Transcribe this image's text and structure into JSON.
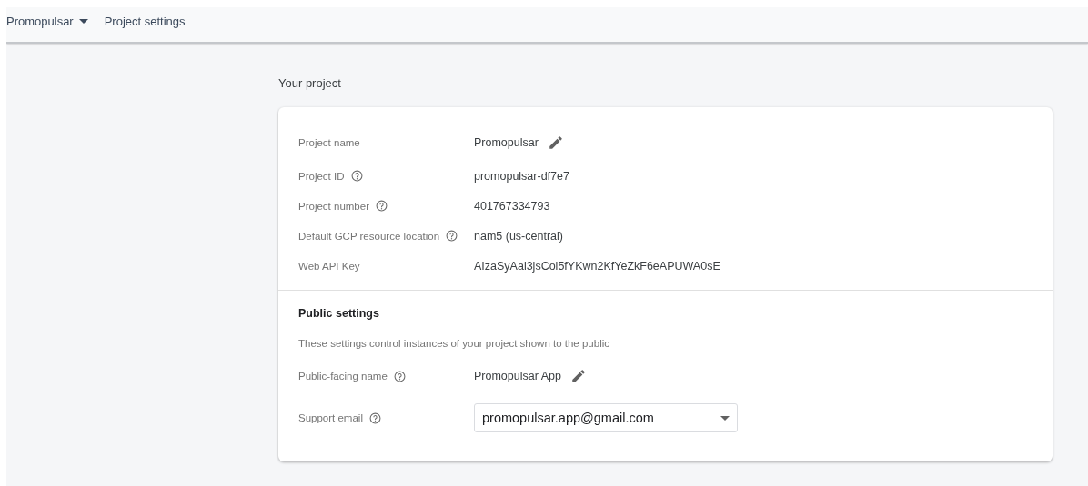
{
  "breadcrumb": {
    "project": "Promopulsar",
    "page": "Project settings"
  },
  "section_title": "Your project",
  "project_rows": [
    {
      "label": "Project name",
      "help": false,
      "kind": "editable",
      "value": "Promopulsar"
    },
    {
      "label": "Project ID",
      "help": true,
      "kind": "text",
      "value": "promopulsar-df7e7"
    },
    {
      "label": "Project number",
      "help": true,
      "kind": "text",
      "value": "401767334793"
    },
    {
      "label": "Default GCP resource location",
      "help": true,
      "kind": "text",
      "value": "nam5 (us-central)"
    },
    {
      "label": "Web API Key",
      "help": false,
      "kind": "text",
      "value": "AIzaSyAai3jsCol5fYKwn2KfYeZkF6eAPUWA0sE"
    }
  ],
  "public_settings": {
    "title": "Public settings",
    "description": "These settings control instances of your project shown to the public",
    "rows": [
      {
        "label": "Public-facing name",
        "help": true,
        "kind": "editable",
        "value": "Promopulsar App"
      },
      {
        "label": "Support email",
        "help": true,
        "kind": "select",
        "value": "promopulsar.app@gmail.com"
      }
    ]
  }
}
